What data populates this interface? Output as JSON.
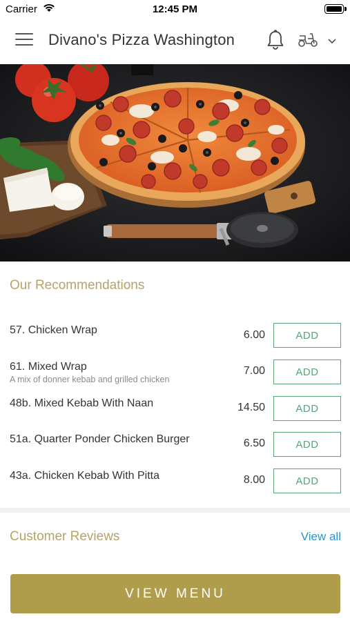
{
  "status_bar": {
    "carrier": "Carrier",
    "time": "12:45 PM"
  },
  "header": {
    "title": "Divano's Pizza Washington",
    "icons": [
      "menu-icon",
      "bell-icon",
      "scooter-icon",
      "chevron-down-icon"
    ]
  },
  "hero": {
    "image": "pizza-photo"
  },
  "recommendations": {
    "title": "Our Recommendations",
    "items": [
      {
        "name": "57. Chicken Wrap",
        "description": "",
        "price": "6.00",
        "button": "ADD"
      },
      {
        "name": "61. Mixed Wrap",
        "description": "A mix of donner kebab and grilled chicken",
        "price": "7.00",
        "button": "ADD"
      },
      {
        "name": "48b. Mixed Kebab With Naan",
        "description": "",
        "price": "14.50",
        "button": "ADD"
      },
      {
        "name": "51a. Quarter Ponder Chicken Burger",
        "description": "",
        "price": "6.50",
        "button": "ADD"
      },
      {
        "name": "43a. Chicken Kebab With Pitta",
        "description": "",
        "price": "8.00",
        "button": "ADD"
      }
    ]
  },
  "reviews": {
    "title": "Customer Reviews",
    "view_all": "View all"
  },
  "footer": {
    "view_menu": "VIEW MENU"
  },
  "colors": {
    "accent_gold": "#b09d4c",
    "title_gold": "#b5a466",
    "add_green": "#58a37a",
    "link_blue": "#2f93c9"
  }
}
